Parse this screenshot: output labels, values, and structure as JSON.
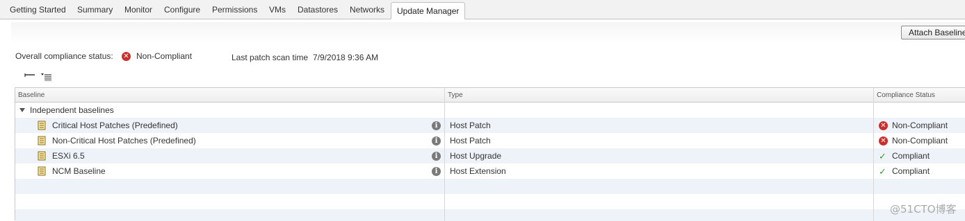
{
  "tabs": [
    {
      "label": "Getting Started",
      "active": false
    },
    {
      "label": "Summary",
      "active": false
    },
    {
      "label": "Monitor",
      "active": false
    },
    {
      "label": "Configure",
      "active": false
    },
    {
      "label": "Permissions",
      "active": false
    },
    {
      "label": "VMs",
      "active": false
    },
    {
      "label": "Datastores",
      "active": false
    },
    {
      "label": "Networks",
      "active": false
    },
    {
      "label": "Update Manager",
      "active": true
    }
  ],
  "toolbar": {
    "attach_label": "Attach Baseline..."
  },
  "summary": {
    "compliance_label": "Overall compliance status:",
    "compliance_value": "Non-Compliant",
    "scan_label": "Last patch scan time",
    "scan_value": "7/9/2018 9:36 AM"
  },
  "grid": {
    "columns": [
      "Baseline",
      "Type",
      "Compliance Status"
    ],
    "group_label": "Independent baselines",
    "rows": [
      {
        "baseline": "Critical Host Patches (Predefined)",
        "type": "Host Patch",
        "status": "Non-Compliant",
        "status_icon": "error-icon"
      },
      {
        "baseline": "Non-Critical Host Patches (Predefined)",
        "type": "Host Patch",
        "status": "Non-Compliant",
        "status_icon": "error-icon"
      },
      {
        "baseline": "ESXi 6.5",
        "type": "Host Upgrade",
        "status": "Compliant",
        "status_icon": "check-icon"
      },
      {
        "baseline": "NCM Baseline",
        "type": "Host Extension",
        "status": "Compliant",
        "status_icon": "check-icon"
      }
    ]
  },
  "watermark": "@51CTO博客",
  "colors": {
    "error": "#c9302c",
    "success": "#3c9a2f",
    "alt_row": "#eef3f9"
  }
}
